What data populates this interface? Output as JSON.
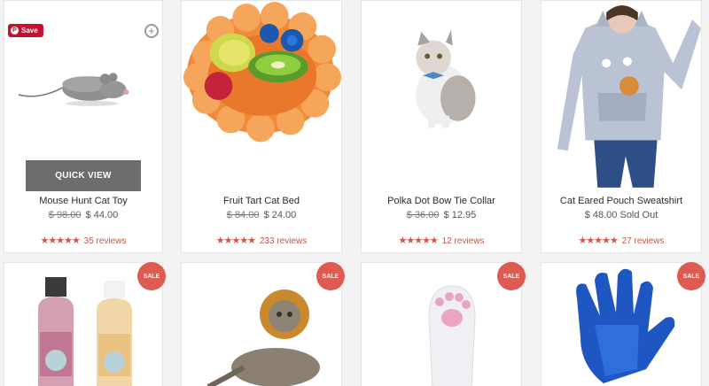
{
  "products": [
    {
      "name": "Mouse Hunt Cat Toy",
      "old_price": "$ 98.00",
      "price": "$ 44.00",
      "stars": "★★★★★",
      "reviews": "35 reviews"
    },
    {
      "name": "Fruit Tart Cat Bed",
      "old_price": "$ 84.00",
      "price": "$ 24.00",
      "stars": "★★★★★",
      "reviews": "233 reviews"
    },
    {
      "name": "Polka Dot Bow Tie Collar",
      "old_price": "$ 36.00",
      "price": "$ 12.95",
      "stars": "★★★★★",
      "reviews": "12 reviews"
    },
    {
      "name": "Cat Eared Pouch Sweatshirt",
      "old_price": "",
      "price": "$ 48.00 Sold Out",
      "stars": "★★★★★",
      "reviews": "27 reviews"
    }
  ],
  "overlay": {
    "save_label": "Save",
    "pinterest_glyph": "P",
    "zoom_glyph": "+",
    "quick_view_label": "QUICK VIEW"
  },
  "sale_badge": "SALE",
  "colors": {
    "accent": "#dd5b52",
    "pinterest": "#c8102e",
    "star": "#d8544a"
  }
}
